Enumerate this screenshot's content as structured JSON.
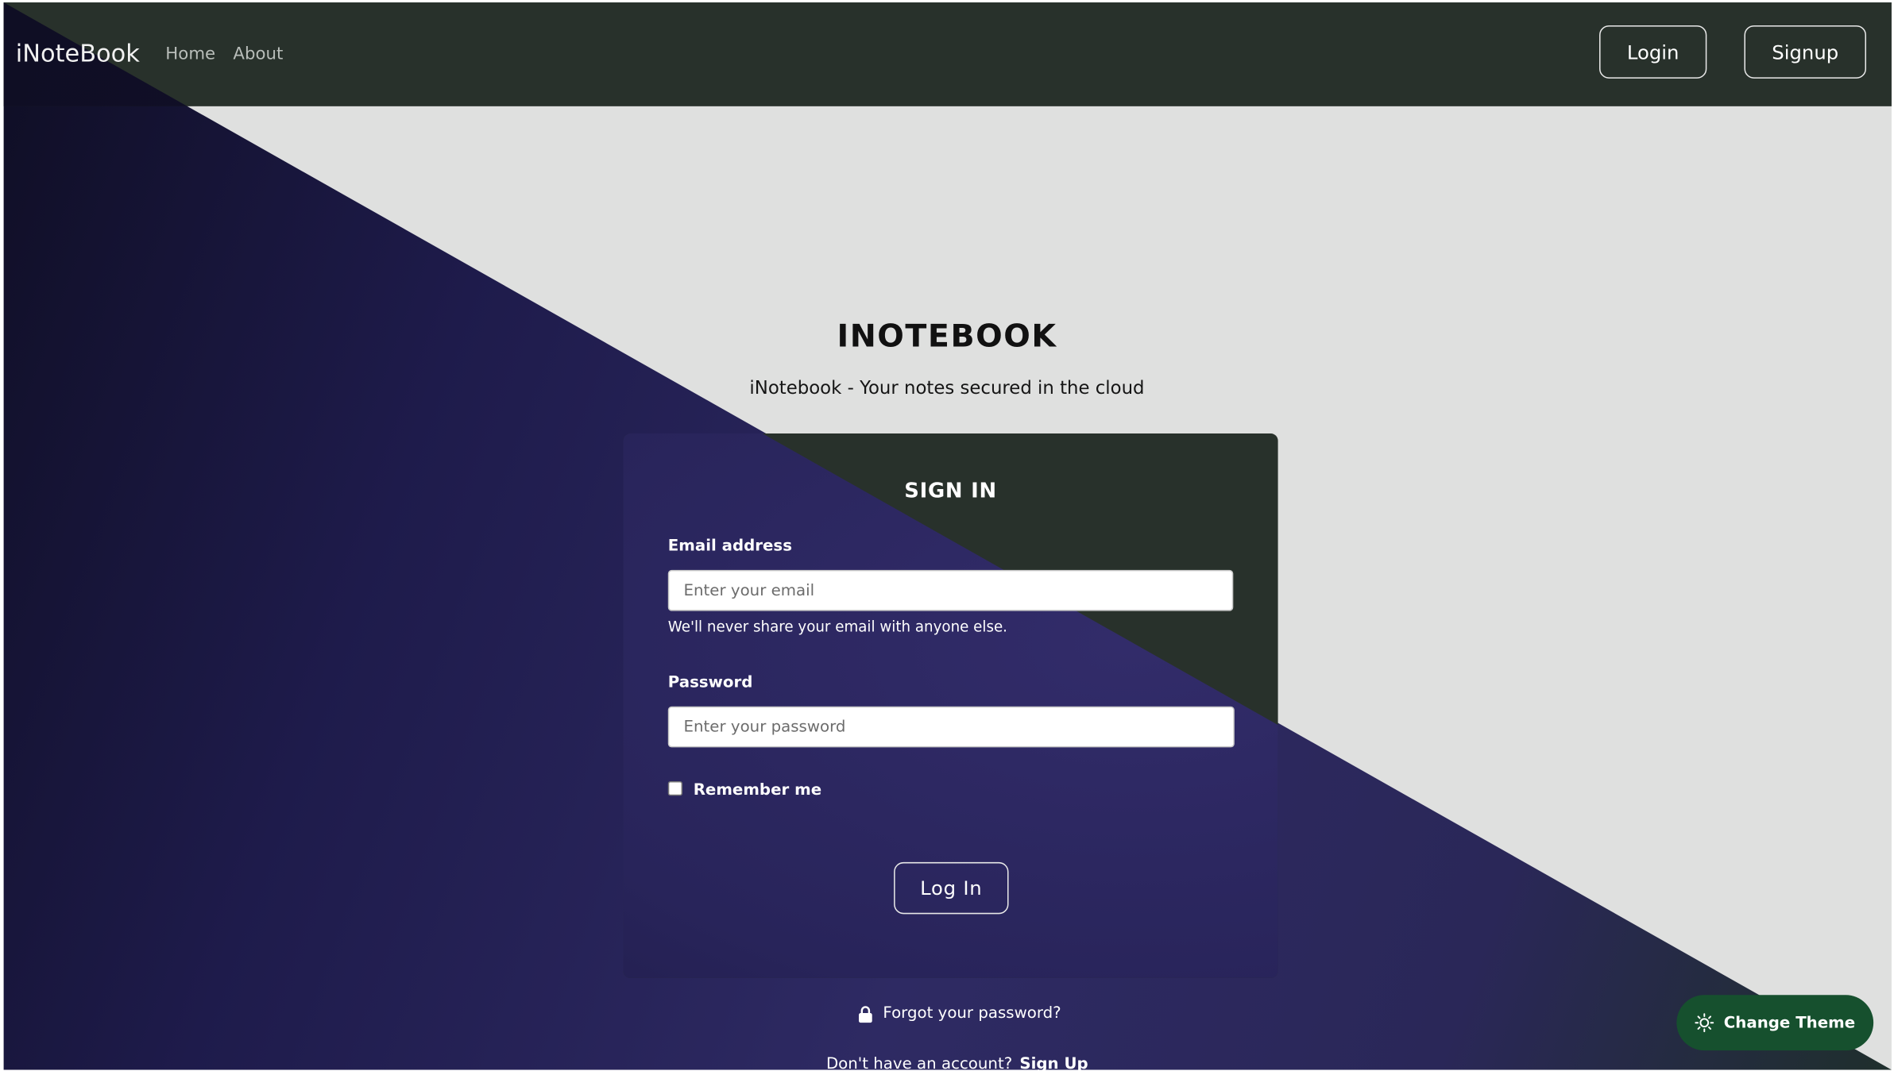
{
  "navbar": {
    "brand": "iNoteBook",
    "links": [
      "Home",
      "About"
    ],
    "login_label": "Login",
    "signup_label": "Signup"
  },
  "hero": {
    "title": "INOTEBOOK",
    "subtitle": "iNotebook - Your notes secured in the cloud"
  },
  "signin": {
    "title": "SIGN IN",
    "email_label": "Email address",
    "email_placeholder": "Enter your email",
    "email_help": "We'll never share your email with anyone else.",
    "password_label": "Password",
    "password_placeholder": "Enter your password",
    "remember_label": "Remember me",
    "submit_label": "Log In"
  },
  "footer": {
    "forgot_label": "Forgot your password?",
    "no_account_text": "Don't have an account?",
    "signup_link": "Sign Up"
  },
  "theme_button": {
    "label": "Change Theme",
    "icon": "sun-icon"
  },
  "colors": {
    "navbar": "#28312b",
    "accent_purple": "#2e2a63",
    "theme_button": "#16502e",
    "background": "#dfe0df"
  }
}
